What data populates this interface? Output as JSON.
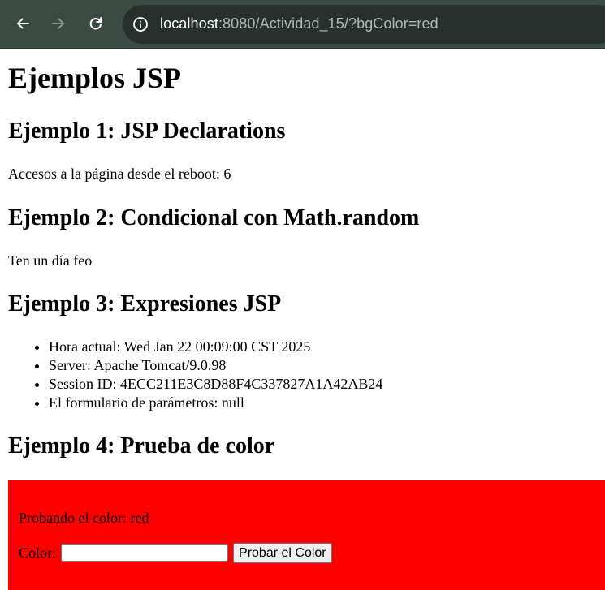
{
  "browser": {
    "url_host": "localhost",
    "url_rest": ":8080/Actividad_15/?bgColor=red",
    "icons": {
      "back": "arrow-left-icon",
      "forward": "arrow-right-icon",
      "reload": "reload-icon",
      "site_info": "info-circle-icon"
    },
    "colors": {
      "toolbar": "#3c4a44",
      "omnibox": "#27302c"
    }
  },
  "page": {
    "title": "Ejemplos JSP",
    "example1": {
      "heading": "Ejemplo 1: JSP Declarations",
      "text": "Accesos a la página desde el reboot: 6"
    },
    "example2": {
      "heading": "Ejemplo 2: Condicional con Math.random",
      "text": "Ten un día feo"
    },
    "example3": {
      "heading": "Ejemplo 3: Expresiones JSP",
      "items": [
        "Hora actual: Wed Jan 22 00:09:00 CST 2025",
        "Server: Apache Tomcat/9.0.98",
        "Session ID: 4ECC211E3C8D88F4C337827A1A42AB24",
        "El formulario de parámetros: null"
      ]
    },
    "example4": {
      "heading": "Ejemplo 4: Prueba de color",
      "bg_color": "#ff0000",
      "probando_text": "Probando el color: red",
      "color_label": "Color:",
      "color_input_value": "",
      "submit_label": "Probar el Color"
    }
  }
}
